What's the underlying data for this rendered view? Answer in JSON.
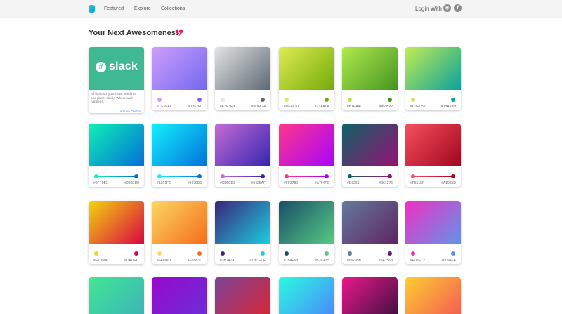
{
  "nav": {
    "links": [
      "Featured",
      "Explore",
      "Collections"
    ],
    "login_label": "Login With",
    "icons": [
      "logo-icon",
      "github-icon",
      "facebook-icon"
    ]
  },
  "page": {
    "title": "Your Next Awesomeness",
    "title_icon": "broken-heart-icon"
  },
  "ad": {
    "brand": "slack",
    "text": "All the tools your team needs in one place. Slack: Where work happens.",
    "via": "ads via Carbon"
  },
  "gradients": [
    {
      "from": "#CE9FFC",
      "to": "#7367F0"
    },
    {
      "from": "#E3E3E3",
      "to": "#5D6874"
    },
    {
      "from": "#DFEC51",
      "to": "#73AA0A"
    },
    {
      "from": "#B1EA4D",
      "to": "#459522"
    },
    {
      "from": "#C3EC52",
      "to": "#0BA29D"
    },
    {
      "from": "#0FF0B3",
      "to": "#036ED9"
    },
    {
      "from": "#13F1FC",
      "to": "#0470DC"
    },
    {
      "from": "#C56CD6",
      "to": "#3425AF"
    },
    {
      "from": "#FF3789",
      "to": "#A704FD"
    },
    {
      "from": "#D6265",
      "to": "#961276"
    },
    {
      "from": "#F5515F",
      "to": "#A1051D"
    },
    {
      "from": "#F2D50F",
      "to": "#DA0641"
    },
    {
      "from": "#FAD961",
      "to": "#F76B1C"
    },
    {
      "from": "#3B247A",
      "to": "#1BCEDF"
    },
    {
      "from": "#184E68",
      "to": "#57CA85"
    },
    {
      "from": "#65799B",
      "to": "#5E2563"
    },
    {
      "from": "#F02FC2",
      "to": "#6094EA"
    }
  ],
  "partial_row": [
    {
      "from": "#42E695",
      "to": "#3BB2B8"
    },
    {
      "from": "#9708CC",
      "to": "#6A2FD8"
    },
    {
      "from": "#7B4397",
      "to": "#DC2430"
    },
    {
      "from": "#2AFADF",
      "to": "#4C83FF"
    },
    {
      "from": "#E8198B",
      "to": "#3B0F3F"
    },
    {
      "from": "#FCCF31",
      "to": "#F55555"
    }
  ]
}
